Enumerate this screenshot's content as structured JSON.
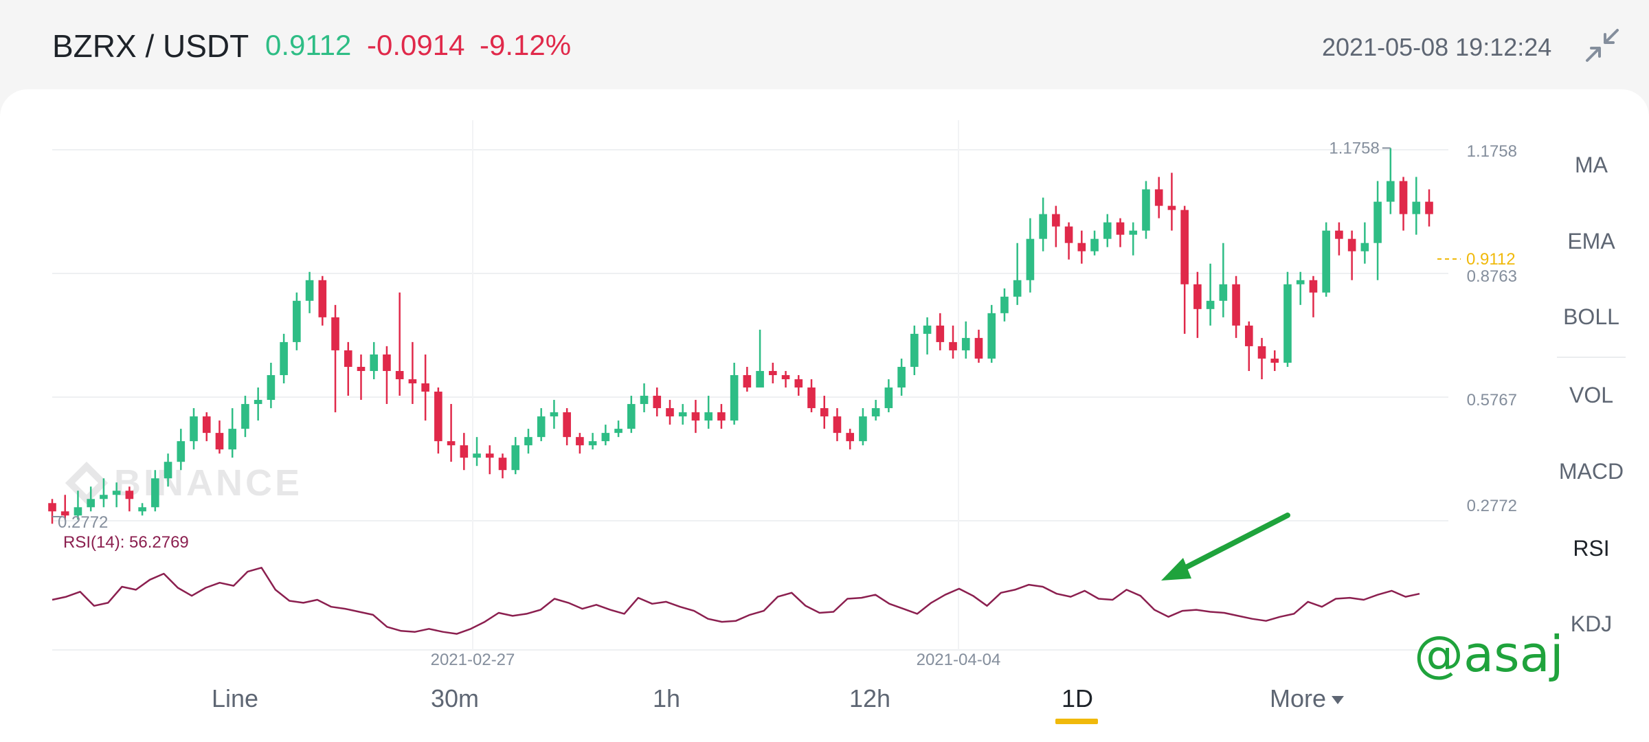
{
  "header": {
    "pair": "BZRX / USDT",
    "price": "0.9112",
    "change": "-0.0914",
    "change_pct": "-9.12%",
    "datetime": "2021-05-08 19:12:24",
    "collapse_icon": "collapse-arrows-icon"
  },
  "colors": {
    "up": "#2ebd85",
    "down": "#e0294a",
    "rsi": "#8b1f4f",
    "last_price": "#f0b90b",
    "arrow": "#1fa33c"
  },
  "watermark": {
    "brand": "BINANCE",
    "handle": "@asaj"
  },
  "indicators": [
    "MA",
    "EMA",
    "BOLL",
    "VOL",
    "MACD",
    "RSI",
    "KDJ"
  ],
  "active_indicator": "RSI",
  "timeframes": [
    "Line",
    "30m",
    "1h",
    "12h",
    "1D",
    "More"
  ],
  "active_timeframe": "1D",
  "chart_data": {
    "type": "candlestick",
    "price_axis": {
      "min": 0.2772,
      "max": 1.1758,
      "ticks": [
        "1.1758",
        "0.8763",
        "0.5767",
        "0.2772"
      ]
    },
    "high_label": "1.1758",
    "low_label": "0.2772",
    "last_price": "0.9112",
    "x_labels": [
      "2021-02-27",
      "2021-04-04"
    ],
    "rsi_label": "RSI(14): 56.2769",
    "ohlc": [
      [
        0.32,
        0.3,
        0.33,
        0.27
      ],
      [
        0.3,
        0.29,
        0.34,
        0.28
      ],
      [
        0.29,
        0.31,
        0.35,
        0.28
      ],
      [
        0.31,
        0.33,
        0.36,
        0.3
      ],
      [
        0.33,
        0.34,
        0.38,
        0.31
      ],
      [
        0.34,
        0.35,
        0.37,
        0.31
      ],
      [
        0.35,
        0.33,
        0.36,
        0.3
      ],
      [
        0.3,
        0.31,
        0.32,
        0.29
      ],
      [
        0.31,
        0.38,
        0.4,
        0.3
      ],
      [
        0.38,
        0.42,
        0.44,
        0.36
      ],
      [
        0.42,
        0.47,
        0.5,
        0.4
      ],
      [
        0.47,
        0.53,
        0.55,
        0.45
      ],
      [
        0.53,
        0.49,
        0.54,
        0.47
      ],
      [
        0.49,
        0.45,
        0.52,
        0.44
      ],
      [
        0.45,
        0.5,
        0.55,
        0.43
      ],
      [
        0.5,
        0.56,
        0.58,
        0.48
      ],
      [
        0.56,
        0.57,
        0.6,
        0.52
      ],
      [
        0.57,
        0.63,
        0.66,
        0.55
      ],
      [
        0.63,
        0.71,
        0.73,
        0.61
      ],
      [
        0.71,
        0.81,
        0.83,
        0.69
      ],
      [
        0.81,
        0.86,
        0.88,
        0.78
      ],
      [
        0.86,
        0.77,
        0.87,
        0.75
      ],
      [
        0.77,
        0.69,
        0.8,
        0.54
      ],
      [
        0.69,
        0.65,
        0.71,
        0.58
      ],
      [
        0.65,
        0.64,
        0.68,
        0.57
      ],
      [
        0.64,
        0.68,
        0.71,
        0.62
      ],
      [
        0.68,
        0.64,
        0.7,
        0.56
      ],
      [
        0.64,
        0.62,
        0.83,
        0.58
      ],
      [
        0.62,
        0.61,
        0.71,
        0.56
      ],
      [
        0.61,
        0.59,
        0.68,
        0.52
      ],
      [
        0.59,
        0.47,
        0.6,
        0.44
      ],
      [
        0.47,
        0.46,
        0.56,
        0.42
      ],
      [
        0.46,
        0.43,
        0.49,
        0.4
      ],
      [
        0.43,
        0.44,
        0.48,
        0.41
      ],
      [
        0.44,
        0.43,
        0.46,
        0.39
      ],
      [
        0.43,
        0.4,
        0.44,
        0.38
      ],
      [
        0.4,
        0.46,
        0.48,
        0.39
      ],
      [
        0.46,
        0.48,
        0.5,
        0.44
      ],
      [
        0.48,
        0.53,
        0.55,
        0.47
      ],
      [
        0.53,
        0.54,
        0.57,
        0.5
      ],
      [
        0.54,
        0.48,
        0.55,
        0.46
      ],
      [
        0.48,
        0.46,
        0.49,
        0.44
      ],
      [
        0.46,
        0.47,
        0.49,
        0.45
      ],
      [
        0.47,
        0.49,
        0.51,
        0.46
      ],
      [
        0.49,
        0.5,
        0.52,
        0.48
      ],
      [
        0.5,
        0.56,
        0.58,
        0.49
      ],
      [
        0.56,
        0.58,
        0.61,
        0.54
      ],
      [
        0.58,
        0.55,
        0.6,
        0.53
      ],
      [
        0.55,
        0.53,
        0.57,
        0.51
      ],
      [
        0.53,
        0.54,
        0.56,
        0.51
      ],
      [
        0.54,
        0.52,
        0.57,
        0.49
      ],
      [
        0.52,
        0.54,
        0.58,
        0.5
      ],
      [
        0.54,
        0.52,
        0.56,
        0.5
      ],
      [
        0.52,
        0.63,
        0.66,
        0.51
      ],
      [
        0.63,
        0.6,
        0.65,
        0.59
      ],
      [
        0.6,
        0.64,
        0.74,
        0.6
      ],
      [
        0.64,
        0.63,
        0.66,
        0.61
      ],
      [
        0.63,
        0.62,
        0.64,
        0.6
      ],
      [
        0.62,
        0.6,
        0.63,
        0.58
      ],
      [
        0.6,
        0.55,
        0.62,
        0.54
      ],
      [
        0.55,
        0.53,
        0.58,
        0.5
      ],
      [
        0.53,
        0.49,
        0.55,
        0.47
      ],
      [
        0.49,
        0.47,
        0.5,
        0.45
      ],
      [
        0.47,
        0.53,
        0.55,
        0.46
      ],
      [
        0.53,
        0.55,
        0.57,
        0.52
      ],
      [
        0.55,
        0.6,
        0.62,
        0.54
      ],
      [
        0.6,
        0.65,
        0.67,
        0.58
      ],
      [
        0.65,
        0.73,
        0.75,
        0.63
      ],
      [
        0.73,
        0.75,
        0.77,
        0.68
      ],
      [
        0.75,
        0.71,
        0.78,
        0.69
      ],
      [
        0.71,
        0.69,
        0.75,
        0.67
      ],
      [
        0.69,
        0.72,
        0.76,
        0.67
      ],
      [
        0.72,
        0.67,
        0.74,
        0.66
      ],
      [
        0.67,
        0.78,
        0.8,
        0.66
      ],
      [
        0.78,
        0.82,
        0.84,
        0.76
      ],
      [
        0.82,
        0.86,
        0.95,
        0.8
      ],
      [
        0.86,
        0.96,
        1.01,
        0.83
      ],
      [
        0.96,
        1.02,
        1.06,
        0.93
      ],
      [
        1.02,
        0.99,
        1.04,
        0.94
      ],
      [
        0.99,
        0.95,
        1.0,
        0.91
      ],
      [
        0.95,
        0.93,
        0.98,
        0.9
      ],
      [
        0.93,
        0.96,
        0.98,
        0.92
      ],
      [
        0.96,
        1.0,
        1.02,
        0.94
      ],
      [
        1.0,
        0.97,
        1.01,
        0.94
      ],
      [
        0.97,
        0.98,
        1.0,
        0.92
      ],
      [
        0.98,
        1.08,
        1.1,
        0.96
      ],
      [
        1.08,
        1.04,
        1.11,
        1.01
      ],
      [
        1.04,
        1.03,
        1.12,
        0.98
      ],
      [
        1.03,
        0.85,
        1.04,
        0.73
      ],
      [
        0.85,
        0.79,
        0.88,
        0.72
      ],
      [
        0.79,
        0.81,
        0.9,
        0.75
      ],
      [
        0.81,
        0.85,
        0.95,
        0.77
      ],
      [
        0.85,
        0.75,
        0.87,
        0.72
      ],
      [
        0.75,
        0.7,
        0.76,
        0.64
      ],
      [
        0.7,
        0.67,
        0.72,
        0.62
      ],
      [
        0.67,
        0.66,
        0.69,
        0.64
      ],
      [
        0.66,
        0.85,
        0.88,
        0.65
      ],
      [
        0.85,
        0.86,
        0.88,
        0.8
      ],
      [
        0.86,
        0.83,
        0.87,
        0.77
      ],
      [
        0.83,
        0.98,
        1.0,
        0.82
      ],
      [
        0.98,
        0.96,
        1.0,
        0.92
      ],
      [
        0.96,
        0.93,
        0.98,
        0.86
      ],
      [
        0.93,
        0.95,
        1.0,
        0.9
      ],
      [
        0.95,
        1.05,
        1.1,
        0.86
      ],
      [
        1.05,
        1.1,
        1.18,
        1.02
      ],
      [
        1.1,
        1.02,
        1.11,
        0.98
      ],
      [
        1.02,
        1.05,
        1.11,
        0.97
      ],
      [
        1.05,
        1.02,
        1.08,
        0.99
      ]
    ],
    "rsi": {
      "range": [
        0,
        100
      ],
      "values": [
        50,
        53,
        58,
        44,
        47,
        63,
        60,
        70,
        76,
        62,
        54,
        62,
        67,
        64,
        78,
        82,
        60,
        49,
        47,
        50,
        43,
        41,
        38,
        35,
        23,
        19,
        18,
        21,
        18,
        16,
        21,
        28,
        37,
        34,
        36,
        40,
        51,
        47,
        41,
        45,
        40,
        36,
        52,
        46,
        48,
        43,
        39,
        31,
        28,
        29,
        35,
        39,
        53,
        57,
        44,
        37,
        38,
        51,
        52,
        55,
        46,
        41,
        36,
        47,
        55,
        61,
        54,
        44,
        57,
        60,
        65,
        63,
        56,
        53,
        59,
        51,
        50,
        60,
        54,
        40,
        33,
        39,
        40,
        38,
        37,
        34,
        31,
        29,
        33,
        36,
        48,
        43,
        51,
        52,
        50,
        55,
        59,
        53,
        56
      ],
      "label_value": "56.2769"
    }
  }
}
